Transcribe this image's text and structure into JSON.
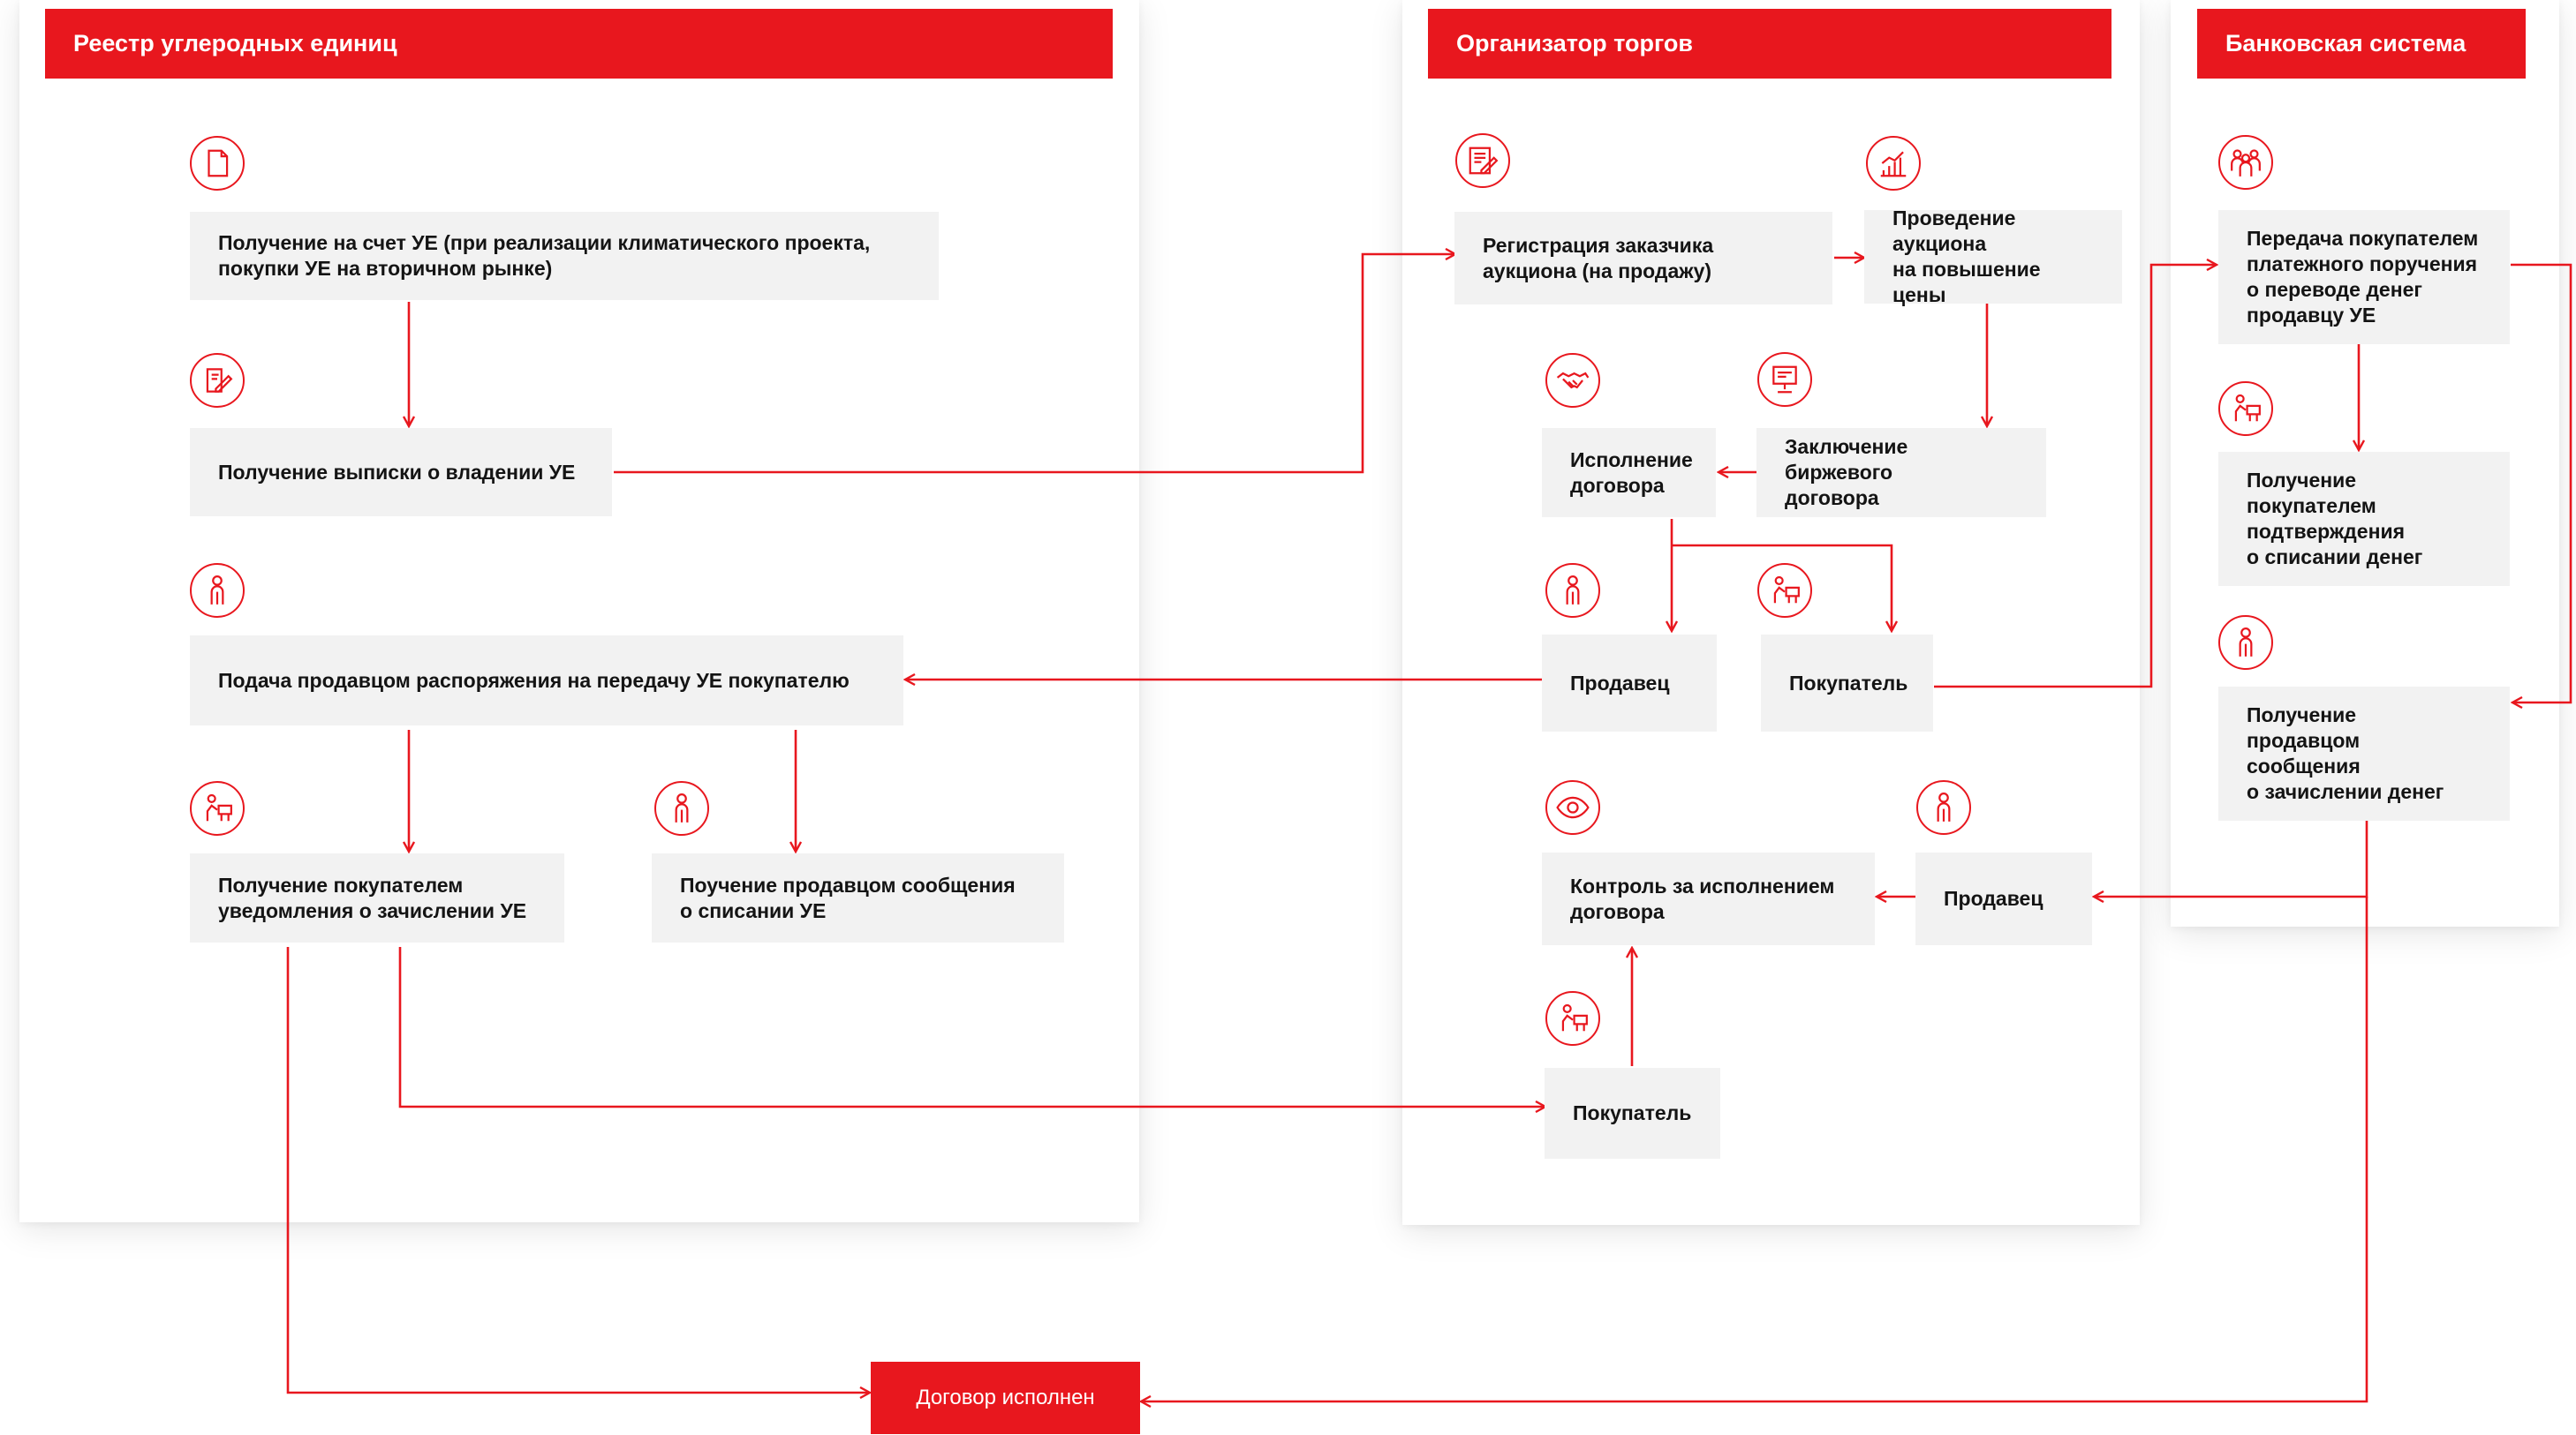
{
  "colors": {
    "accent": "#e8171e",
    "box": "#f2f2f2",
    "text": "#141414"
  },
  "columns": {
    "registry": "Реестр углеродных единиц",
    "trading": "Организатор торгов",
    "bank": "Банковская система"
  },
  "steps": {
    "receipt_to_account": "Получение на счет УЕ (при реализации климатического проекта,\nпокупки УЕ на вторичном рынке)",
    "ownership_statement": "Получение выписки о владении УЕ",
    "seller_transfer_order": "Подача продавцом распоряжения на передачу УЕ покупателю",
    "buyer_credit_notice": "Получение покупателем\nуведомления о зачислении УЕ",
    "seller_writeoff_notice": "Поучение продавцом сообщения\nо списании УЕ",
    "customer_registration": "Регистрация заказчика\nаукциона (на продажу)",
    "auction": "Проведение\nаукциона\nна повышение цены",
    "exchange_contract": "Заключение биржевого\nдоговора",
    "contract_execution": "Исполнение\nдоговора",
    "seller_1": "Продавец",
    "buyer_1": "Покупатель",
    "execution_control": "Контроль за исполнением\nдоговора",
    "seller_2": "Продавец",
    "buyer_2": "Покупатель",
    "payment_order": "Передача покупателем\nплатежного поручения\nо переводе денег\nпродавцу УЕ",
    "buyer_debit_confirmation": "Получение\nпокупателем\nподтверждения\nо списании денег",
    "seller_credit_message": "Получение\nпродавцом\nсообщения\nо зачислении денег"
  },
  "final": "Договор исполнен",
  "icons": {
    "receipt_to_account": "document-icon",
    "ownership_statement": "signing-icon",
    "seller_transfer_order": "person-icon",
    "buyer_credit_notice": "person-at-desk-icon",
    "seller_writeoff_notice": "person-icon",
    "customer_registration": "registration-form-icon",
    "auction": "growth-chart-icon",
    "contract_execution": "handshake-icon",
    "exchange_contract": "exchange-terminal-icon",
    "seller_1": "person-icon",
    "buyer_1": "person-at-desk-icon",
    "execution_control": "eye-icon",
    "seller_2": "person-icon",
    "buyer_2": "person-at-desk-icon",
    "payment_order": "people-group-icon",
    "buyer_debit_confirmation": "person-at-desk-icon",
    "seller_credit_message": "person-icon"
  }
}
